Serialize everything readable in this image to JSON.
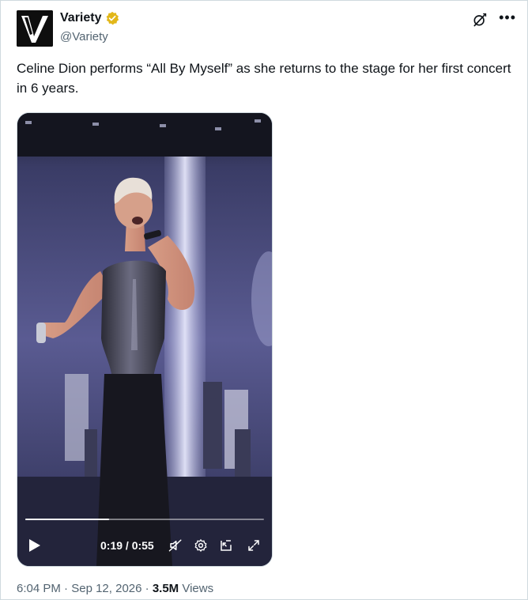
{
  "author": {
    "name": "Variety",
    "handle": "@Variety",
    "avatar_letter": "V"
  },
  "icons": {
    "verified": "verified-badge-icon",
    "grok": "grok-icon",
    "more": "more-icon"
  },
  "tweet": {
    "text": "Celine Dion performs “All By Myself” as she returns to the stage for her first concert in 6 years."
  },
  "video": {
    "current_time": "0:19",
    "duration": "0:55",
    "time_display": "0:19 / 0:55",
    "progress": 0.35
  },
  "meta": {
    "time": "6:04 PM",
    "separator": " · ",
    "date": "Sep 12, 2026",
    "views_count": "3.5M",
    "views_label": "Views"
  },
  "colors": {
    "verified": "#e2b719",
    "text_primary": "#0f1419",
    "text_secondary": "#536471"
  }
}
